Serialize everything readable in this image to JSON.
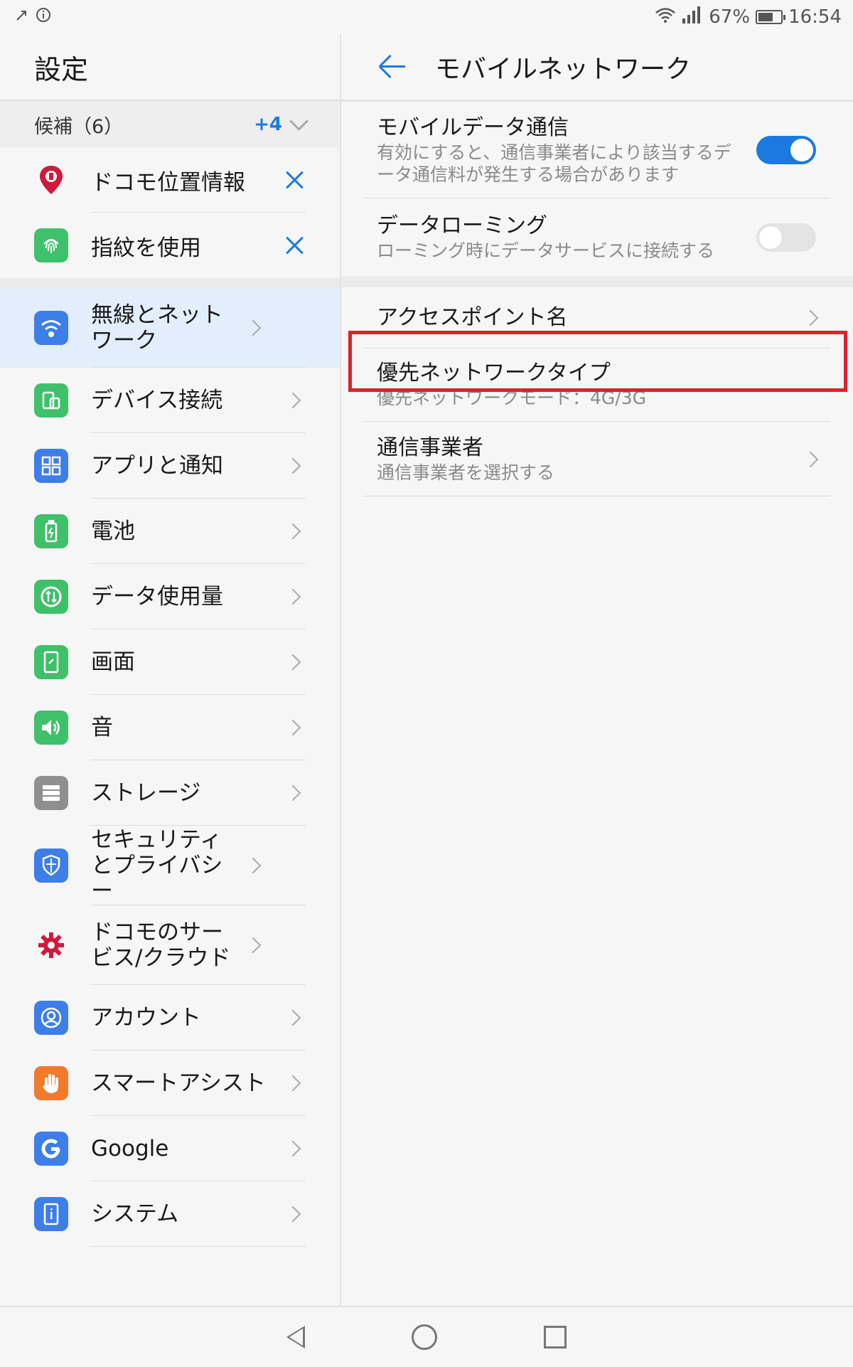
{
  "status_bar": {
    "battery_percent": "67%",
    "time": "16:54",
    "battery_level": 0.67
  },
  "left": {
    "title": "設定",
    "suggestions": {
      "header": "候補（6）",
      "more": "+4",
      "items": [
        {
          "label": "ドコモ位置情報",
          "icon": "docomo-location-icon"
        },
        {
          "label": "指紋を使用",
          "icon": "fingerprint-icon"
        }
      ]
    },
    "menu": [
      {
        "label": "無線とネットワーク",
        "icon": "wifi-icon",
        "selected": true,
        "color": "#3d7ee8"
      },
      {
        "label": "デバイス接続",
        "icon": "device-connection-icon",
        "color": "#3fc06a"
      },
      {
        "label": "アプリと通知",
        "icon": "apps-icon",
        "color": "#3d7ee8"
      },
      {
        "label": "電池",
        "icon": "battery-icon",
        "color": "#3fc06a"
      },
      {
        "label": "データ使用量",
        "icon": "data-usage-icon",
        "color": "#3fc06a"
      },
      {
        "label": "画面",
        "icon": "display-icon",
        "color": "#3fc06a"
      },
      {
        "label": "音",
        "icon": "sound-icon",
        "color": "#3fc06a"
      },
      {
        "label": "ストレージ",
        "icon": "storage-icon",
        "color": "#8f8f8f"
      },
      {
        "label": "セキュリティとプライバシー",
        "icon": "security-icon",
        "color": "#3d7ee8"
      },
      {
        "label": "ドコモのサービス/クラウド",
        "icon": "docomo-gear-icon",
        "color": "#d0193c"
      },
      {
        "label": "アカウント",
        "icon": "account-icon",
        "color": "#3d7ee8"
      },
      {
        "label": "スマートアシスト",
        "icon": "smart-assist-icon",
        "color": "#f27a2c"
      },
      {
        "label": "Google",
        "icon": "google-icon",
        "color": "#3d7ee8"
      },
      {
        "label": "システム",
        "icon": "system-icon",
        "color": "#3d7ee8"
      }
    ]
  },
  "right": {
    "title": "モバイルネットワーク",
    "mobile_data": {
      "title": "モバイルデータ通信",
      "sub": "有効にすると、通信事業者により該当するデータ通信料が発生する場合があります",
      "enabled": true
    },
    "roaming": {
      "title": "データローミング",
      "sub": "ローミング時にデータサービスに接続する",
      "enabled": false
    },
    "apn": {
      "title": "アクセスポイント名"
    },
    "network_type": {
      "title": "優先ネットワークタイプ",
      "sub": "優先ネットワークモード：4G/3G"
    },
    "carrier": {
      "title": "通信事業者",
      "sub": "通信事業者を選択する"
    }
  },
  "colors": {
    "accent": "#1a7ae0",
    "highlight": "#e0202a"
  }
}
